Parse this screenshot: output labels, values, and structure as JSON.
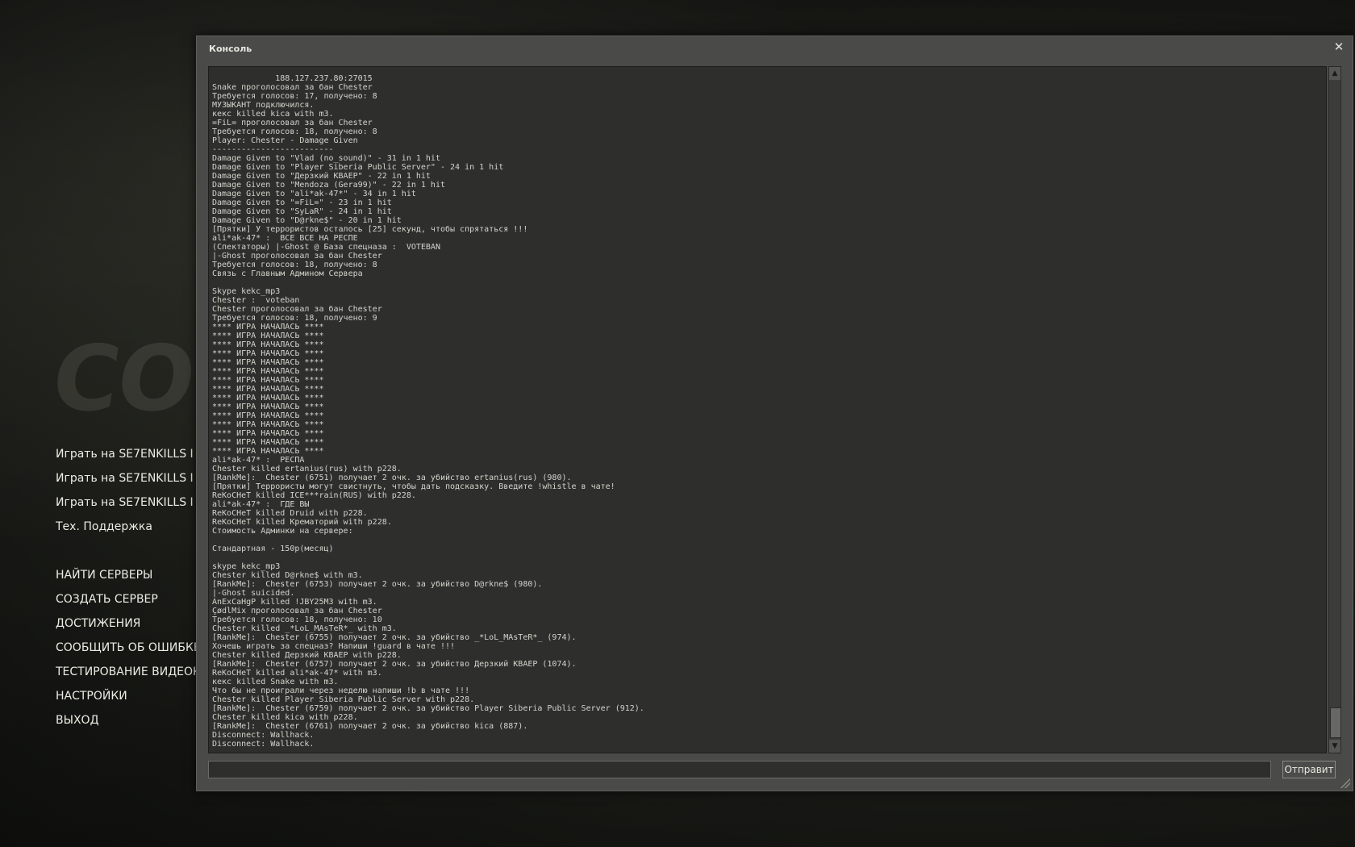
{
  "background": {
    "logo_text": "COUNTER-STRIKE"
  },
  "menu": {
    "items": [
      "Играть на SE7ENKILLS I",
      "Играть на SE7ENKILLS I",
      "Играть на SE7ENKILLS I",
      "Тех. Поддержка",
      "НАЙТИ СЕРВЕРЫ",
      "СОЗДАТЬ СЕРВЕР",
      "ДОСТИЖЕНИЯ",
      "СООБЩИТЬ ОБ ОШИБКЕ",
      "ТЕСТИРОВАНИЕ ВИДЕОКА",
      "НАСТРОЙКИ",
      "ВЫХОД"
    ]
  },
  "console": {
    "title": "Консоль",
    "close_glyph": "✕",
    "send_label": "Отправит",
    "input_value": "",
    "lines": [
      "             188.127.237.80:27015",
      "Snake проголосовал за бан Chester",
      "Требуется голосов: 17, получено: 8",
      "МУЗЫКАНТ подключился.",
      "кекс killed kica with m3.",
      "=FiL= проголосовал за бан Chester",
      "Требуется голосов: 18, получено: 8",
      "Player: Chester - Damage Given",
      "-------------------------",
      "Damage Given to \"Vlad (no_sound)\" - 31 in 1 hit",
      "Damage Given to \"Player Siberia Public Server\" - 24 in 1 hit",
      "Damage Given to \"Дерзкий KBAEP\" - 22 in 1 hit",
      "Damage Given to \"Mendoza (Gera99)\" - 22 in 1 hit",
      "Damage Given to \"ali*ak-47*\" - 34 in 1 hit",
      "Damage Given to \"=FiL=\" - 23 in 1 hit",
      "Damage Given to \"SyLaR\" - 24 in 1 hit",
      "Damage Given to \"D@rkne$\" - 20 in 1 hit",
      "[Прятки] У террористов осталось [25] секунд, чтобы спрятаться !!!",
      "ali*ak-47* :  ВСЕ ВСЕ НА РЕСПЕ",
      "(Спектаторы) |-Ghost @ База спецназа :  VOTEBAN",
      "|-Ghost проголосовал за бан Chester",
      "Требуется голосов: 18, получено: 8",
      "Связь с Главным Админом Сервера",
      "",
      "Skype kekc_mp3",
      "Chester :  voteban",
      "Chester проголосовал за бан Chester",
      "Требуется голосов: 18, получено: 9",
      "**** ИГРА НАЧАЛАСЬ ****",
      "**** ИГРА НАЧАЛАСЬ ****",
      "**** ИГРА НАЧАЛАСЬ ****",
      "**** ИГРА НАЧАЛАСЬ ****",
      "**** ИГРА НАЧАЛАСЬ ****",
      "**** ИГРА НАЧАЛАСЬ ****",
      "**** ИГРА НАЧАЛАСЬ ****",
      "**** ИГРА НАЧАЛАСЬ ****",
      "**** ИГРА НАЧАЛАСЬ ****",
      "**** ИГРА НАЧАЛАСЬ ****",
      "**** ИГРА НАЧАЛАСЬ ****",
      "**** ИГРА НАЧАЛАСЬ ****",
      "**** ИГРА НАЧАЛАСЬ ****",
      "**** ИГРА НАЧАЛАСЬ ****",
      "**** ИГРА НАЧАЛАСЬ ****",
      "ali*ak-47* :  РЕСПА",
      "Chester killed ertanius(rus) with p228.",
      "[RankMe]:  Chester (6751) получает 2 очк. за убийство ertanius(rus) (980).",
      "[Прятки] Террористы могут свистнуть, чтобы дать подсказку. Введите !whistle в чате!",
      "ReKoCHeT killed ICE***rain(RUS) with p228.",
      "ali*ak-47* :  ГДЕ ВЫ",
      "ReKoCHeT killed Druid with p228.",
      "ReKoCHeT killed Крематорий with p228.",
      "Стоимость Админки на сервере:",
      "",
      "Стандартная - 150р(месяц)",
      "",
      "skype kekc_mp3",
      "Chester killed D@rkne$ with m3.",
      "[RankMe]:  Chester (6753) получает 2 очк. за убийство D@rkne$ (980).",
      "|-Ghost suicided.",
      "AnExCaHgP killed !JBY25M3 with m3.",
      "ÇødlMix проголосовал за бан Chester",
      "Требуется голосов: 18, получено: 10",
      "Chester killed _*LoL_MAsTeR*_ with m3.",
      "[RankMe]:  Chester (6755) получает 2 очк. за убийство _*LoL_MAsTeR*_ (974).",
      "Хочешь играть за спецназ? Напиши !guard в чате !!!",
      "Chester killed Дерзкий KBAEP with p228.",
      "[RankMe]:  Chester (6757) получает 2 очк. за убийство Дерзкий KBAEP (1074).",
      "ReKoCHeT killed ali*ak-47* with m3.",
      "кекс killed Snake with m3.",
      "Что бы не проиграли через неделю напиши !b в чате !!!",
      "Chester killed Player Siberia Public Server with p228.",
      "[RankMe]:  Chester (6759) получает 2 очк. за убийство Player Siberia Public Server (912).",
      "Chester killed kica with p228.",
      "[RankMe]:  Chester (6761) получает 2 очк. за убийство kica (887).",
      "Disconnect: Wallhack.",
      "Disconnect: Wallhack."
    ]
  }
}
